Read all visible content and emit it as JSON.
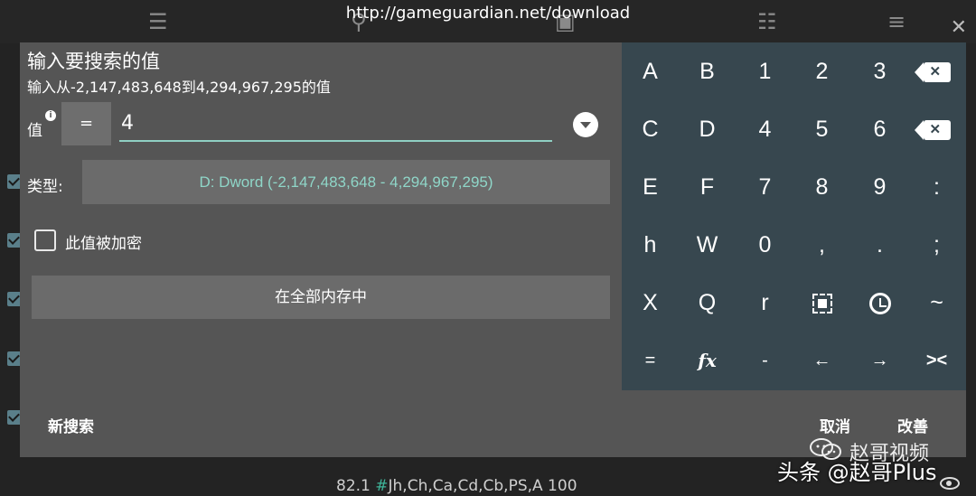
{
  "background": {
    "url_banner": "http://gameguardian.net/download",
    "status_prefix": "82.1",
    "status_hash": "#",
    "status_text": "Jh,Ch,Ca,Cd,Cb,PS,A 100"
  },
  "dialog": {
    "title": "输入要搜索的值",
    "subtitle": "输入从-2,147,483,648到4,294,967,295的值",
    "value_label": "值",
    "operator": "=",
    "value": "4",
    "type_label": "类型:",
    "type_value": "D: Dword (-2,147,483,648 - 4,294,967,295)",
    "encrypted_label": "此值被加密",
    "encrypted_checked": false,
    "region_button": "在全部内存中",
    "new_search": "新搜索",
    "cancel": "取消",
    "modify": "改善"
  },
  "keypad": {
    "rows": [
      [
        "A",
        "B",
        "1",
        "2",
        "3",
        "backspace-icon"
      ],
      [
        "C",
        "D",
        "4",
        "5",
        "6",
        "delete-icon"
      ],
      [
        "E",
        "F",
        "7",
        "8",
        "9",
        ":"
      ],
      [
        "h",
        "W",
        "0",
        ",",
        ".",
        ";"
      ],
      [
        "X",
        "Q",
        "r",
        "select-icon",
        "history-icon",
        "~"
      ],
      [
        "=",
        "fx",
        "-",
        "←",
        "→",
        "><"
      ]
    ]
  },
  "watermark": {
    "line1": "赵哥视频",
    "line2": "头条 @赵哥Plus"
  }
}
